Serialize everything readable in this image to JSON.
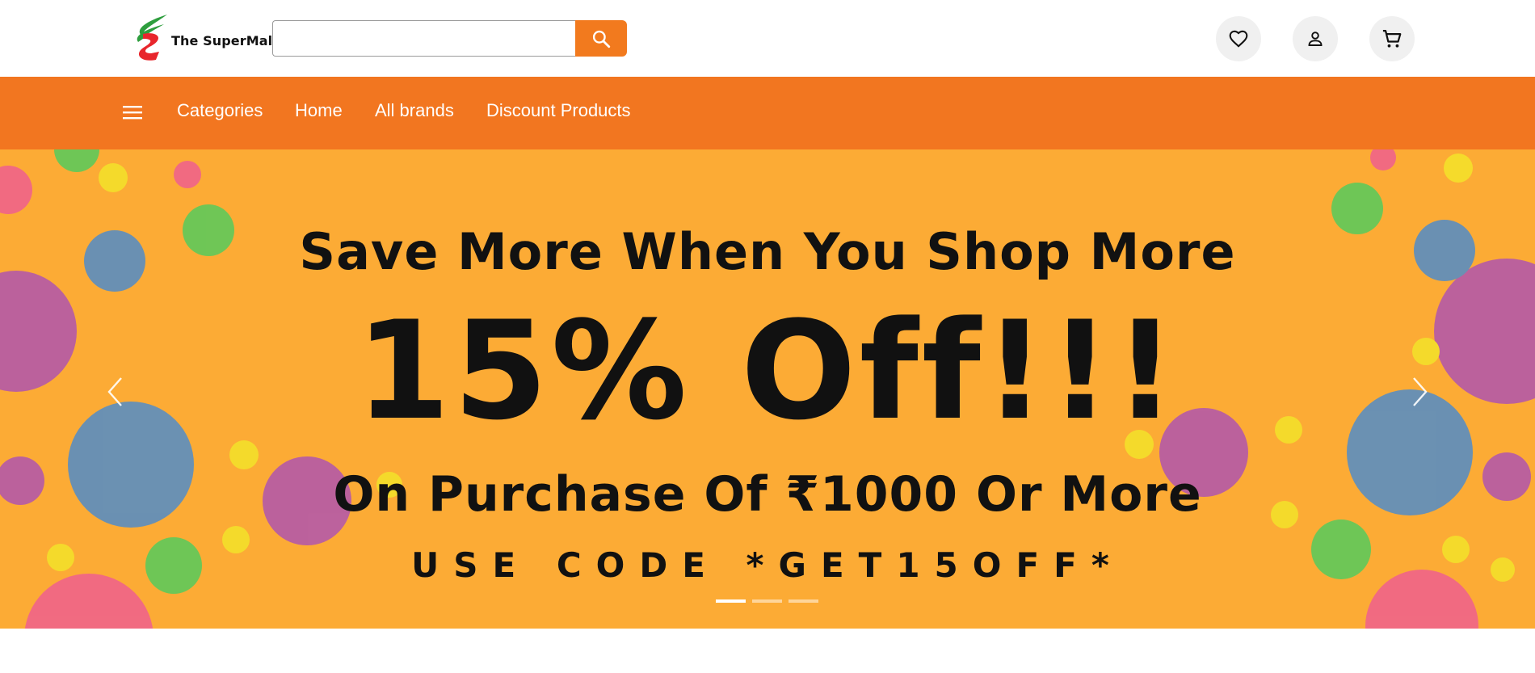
{
  "header": {
    "logo_text": "The SuperMall",
    "search": {
      "value": "",
      "placeholder": ""
    },
    "icons": [
      "wishlist-heart-icon",
      "user-account-icon",
      "cart-icon"
    ]
  },
  "navbar": {
    "background_color": "#f27620",
    "links": [
      "Categories",
      "Home",
      "All brands",
      "Discount Products"
    ]
  },
  "banner": {
    "background_color": "#fcab35",
    "headline": "Save More When You Shop More",
    "offer": "15% Off!!!",
    "subline": "On Purchase Of ₹1000 Or More",
    "code_line": "USE CODE *GET15OFF*",
    "slide_count": 3,
    "active_slide": 1
  },
  "colors": {
    "accent": "#f27a1e"
  }
}
